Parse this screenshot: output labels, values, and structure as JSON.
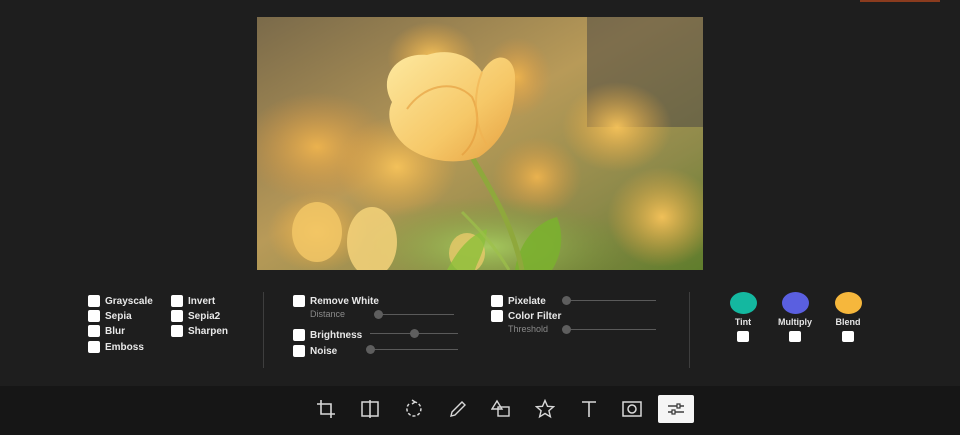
{
  "filters": {
    "col1": [
      {
        "id": "grayscale",
        "label": "Grayscale"
      },
      {
        "id": "sepia",
        "label": "Sepia"
      },
      {
        "id": "blur",
        "label": "Blur"
      },
      {
        "id": "emboss",
        "label": "Emboss"
      }
    ],
    "col2": [
      {
        "id": "invert",
        "label": "Invert"
      },
      {
        "id": "sepia2",
        "label": "Sepia2"
      },
      {
        "id": "sharpen",
        "label": "Sharpen"
      }
    ],
    "remove_white": {
      "label": "Remove White",
      "sub_label": "Distance",
      "value": 0.0
    },
    "brightness": {
      "label": "Brightness",
      "value": 0.5
    },
    "noise": {
      "label": "Noise",
      "value": 0.0
    },
    "pixelate": {
      "label": "Pixelate",
      "value": 0.0
    },
    "color_filter": {
      "label": "Color Filter",
      "sub_label": "Threshold",
      "value": 0.0
    }
  },
  "swatches": [
    {
      "id": "tint",
      "label": "Tint",
      "color": "#14b8a0"
    },
    {
      "id": "multiply",
      "label": "Multiply",
      "color": "#5a5fe0"
    },
    {
      "id": "blend",
      "label": "Blend",
      "color": "#f6b73c"
    }
  ],
  "toolbar": {
    "tools": [
      {
        "id": "crop",
        "icon": "crop-icon"
      },
      {
        "id": "flip",
        "icon": "flip-icon"
      },
      {
        "id": "rotate",
        "icon": "rotate-icon"
      },
      {
        "id": "draw",
        "icon": "pencil-icon"
      },
      {
        "id": "shape",
        "icon": "shape-icon"
      },
      {
        "id": "icon",
        "icon": "star-icon"
      },
      {
        "id": "text",
        "icon": "text-icon"
      },
      {
        "id": "mask",
        "icon": "mask-icon"
      },
      {
        "id": "filter",
        "icon": "sliders-icon",
        "active": true
      }
    ]
  }
}
